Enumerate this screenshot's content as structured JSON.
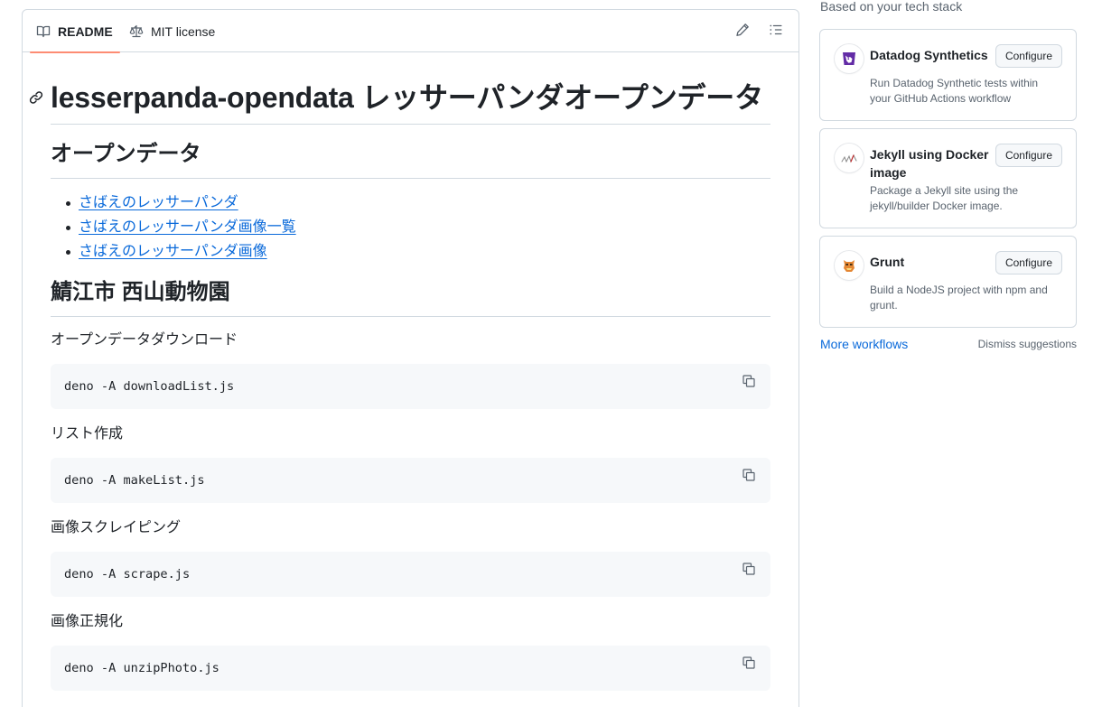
{
  "readme": {
    "tabs": [
      {
        "label": "README",
        "icon": "book-icon"
      },
      {
        "label": "MIT license",
        "icon": "law-icon"
      }
    ],
    "actions": {
      "edit_icon": "pencil-icon",
      "toc_icon": "list-icon"
    },
    "title": "lesserpanda-opendata レッサーパンダオープンデータ",
    "opendata": {
      "heading": "オープンデータ",
      "links": [
        "さばえのレッサーパンダ",
        "さばえのレッサーパンダ画像一覧",
        "さばえのレッサーパンダ画像"
      ]
    },
    "zoo": {
      "heading": "鯖江市 西山動物園",
      "steps": [
        {
          "label": "オープンデータダウンロード",
          "code": "deno -A downloadList.js"
        },
        {
          "label": "リスト作成",
          "code": "deno -A makeList.js"
        },
        {
          "label": "画像スクレイピング",
          "code": "deno -A scrape.js"
        },
        {
          "label": "画像正規化",
          "code": "deno -A unzipPhoto.js"
        }
      ]
    }
  },
  "sidebar": {
    "heading": "Based on your tech stack",
    "cards": [
      {
        "title": "Datadog Synthetics",
        "description": "Run Datadog Synthetic tests within your GitHub Actions workflow",
        "button": "Configure",
        "icon": "datadog-logo-icon"
      },
      {
        "title": "Jekyll using Docker image",
        "description": "Package a Jekyll site using the jekyll/builder Docker image.",
        "button": "Configure",
        "icon": "jekyll-logo-icon"
      },
      {
        "title": "Grunt",
        "description": "Build a NodeJS project with npm and grunt.",
        "button": "Configure",
        "icon": "grunt-logo-icon"
      }
    ],
    "more_workflows": "More workflows",
    "dismiss": "Dismiss suggestions"
  },
  "colors": {
    "link": "#0969da",
    "tab_underline": "#fd8c73",
    "code_bg": "#f6f8fa",
    "border": "#d1d9e0",
    "muted": "#59636e"
  }
}
